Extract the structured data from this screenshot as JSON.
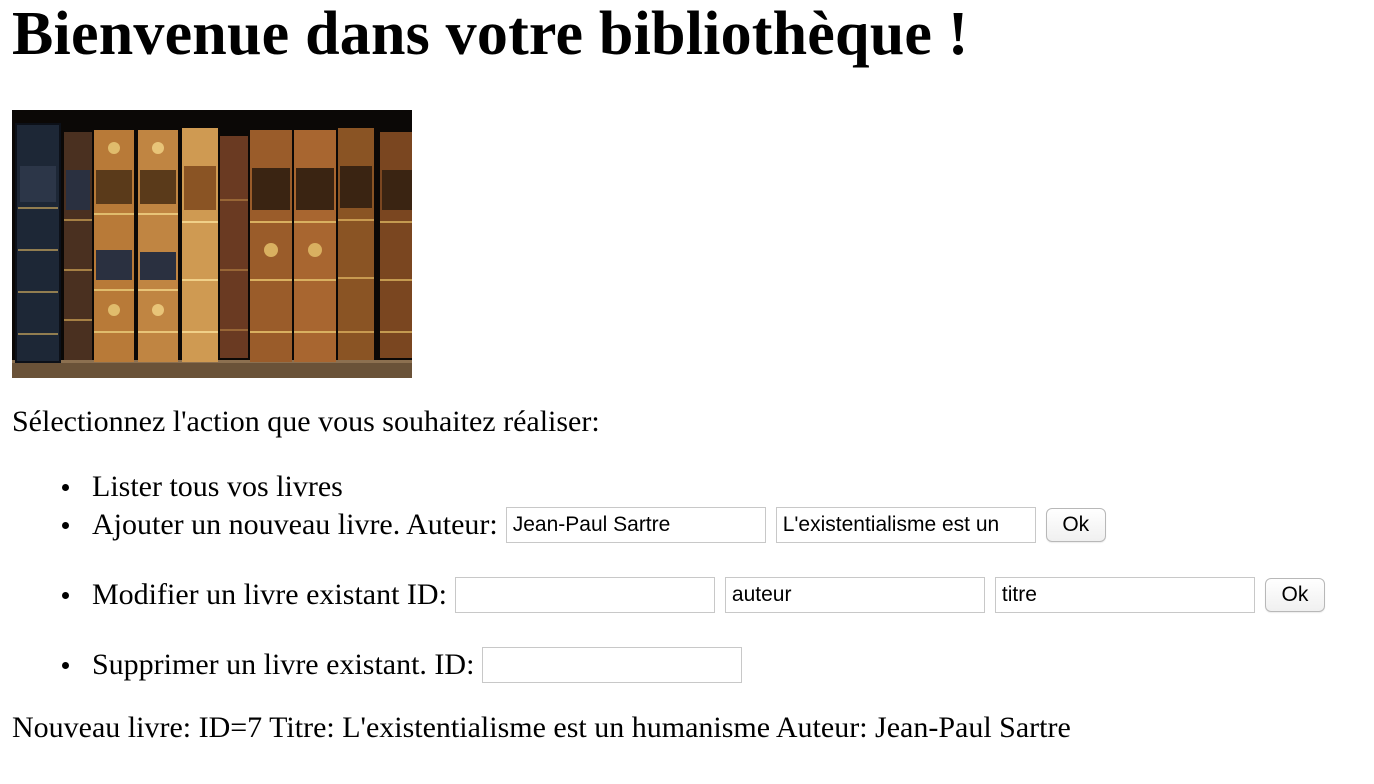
{
  "title": "Bienvenue dans votre bibliothèque !",
  "image": {
    "icon": "bookshelf-image",
    "colors": {
      "background": "#0b0806",
      "leather_dark": "#3a2412",
      "leather_mid": "#8a5424",
      "leather_light": "#c28a45",
      "gold": "#d9b060",
      "navy": "#1d2736"
    }
  },
  "prompt": "Sélectionnez l'action que vous souhaitez réaliser:",
  "actions": {
    "list": {
      "label": "Lister tous vos livres"
    },
    "add": {
      "label": "Ajouter un nouveau livre. Auteur:",
      "author_value": "Jean-Paul Sartre",
      "title_value": "L'existentialisme est un",
      "ok_label": "Ok"
    },
    "edit": {
      "label": "Modifier un livre existant ID:",
      "id_value": "",
      "author_value": "auteur",
      "title_value": "titre",
      "ok_label": "Ok"
    },
    "delete": {
      "label": "Supprimer un livre existant. ID:",
      "id_value": ""
    }
  },
  "result": "Nouveau livre: ID=7 Titre: L'existentialisme est un humanisme Auteur: Jean-Paul Sartre"
}
